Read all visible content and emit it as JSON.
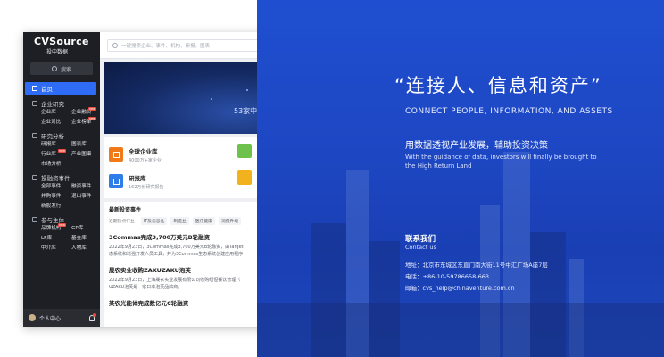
{
  "app": {
    "logo": {
      "main": "CVSource",
      "sub": "投中数据"
    },
    "sidebar": {
      "search_label": "搜索",
      "home": "首页",
      "groups": [
        {
          "title": "企业研究",
          "items": [
            {
              "label": "企业库",
              "badge": ""
            },
            {
              "label": "企业融资",
              "badge": "new"
            },
            {
              "label": "企业对比",
              "badge": ""
            },
            {
              "label": "企业榜单",
              "badge": "new"
            }
          ]
        },
        {
          "title": "研究分析",
          "items": [
            {
              "label": "研报库",
              "badge": ""
            },
            {
              "label": "图表库",
              "badge": ""
            },
            {
              "label": "行业库",
              "badge": "new"
            },
            {
              "label": "产业图谱",
              "badge": ""
            },
            {
              "label": "市场分析",
              "badge": ""
            }
          ]
        },
        {
          "title": "投融资事件",
          "items": [
            {
              "label": "全部事件",
              "badge": ""
            },
            {
              "label": "融资事件",
              "badge": ""
            },
            {
              "label": "并购事件",
              "badge": ""
            },
            {
              "label": "退出事件",
              "badge": ""
            },
            {
              "label": "新股发行",
              "badge": ""
            }
          ]
        },
        {
          "title": "参与主体",
          "items": [
            {
              "label": "品牌机构",
              "badge": "new"
            },
            {
              "label": "GP库",
              "badge": ""
            },
            {
              "label": "LP库",
              "badge": ""
            },
            {
              "label": "基金库",
              "badge": ""
            },
            {
              "label": "中介库",
              "badge": ""
            },
            {
              "label": "人物库",
              "badge": ""
            }
          ]
        }
      ],
      "user": "个人中心"
    },
    "top_search_placeholder": "一键搜索企业、事件、机构、研报、图表",
    "banner_text": "53家中",
    "cards": [
      {
        "title": "全球企业库",
        "sub": "4000万+家企业",
        "color": "#f07a1a"
      },
      {
        "title": "研报库",
        "sub": "162万份研究报告",
        "color": "#2f7de8"
      }
    ],
    "card_right_colors": [
      "#6ec24b",
      "#f2b21e"
    ],
    "events": {
      "title": "最新投资事件",
      "tags": [
        "近期热点行业",
        "IT及信息化",
        "制造业",
        "医疗健康",
        "消费升级"
      ],
      "items": [
        {
          "head": "3Commas完成3,700万美元B轮融资",
          "body": [
            "2022年9月23日，3Commas完成3,700万美元B轮融资，由Target",
            "态系统和增强开发人员工具，并为3Commas生态系统创建应用程序"
          ]
        },
        {
          "head": "晟农实业收购ZAKUZAKU泡芙",
          "body": [
            "2022年9月23日，上海晟农实业发展有限公司收购纽恒餐饮管理（",
            "UZAKU泡芙是一家日本泡芙品牌商。"
          ]
        },
        {
          "head": "某农光能体完成数亿元C轮融资",
          "body": []
        }
      ]
    }
  },
  "panel": {
    "tagline": "“连接人、信息和资产”",
    "tagline_en": "CONNECT PEOPLE, INFORMATION, AND ASSETS",
    "sub_cn": "用数据透视产业发展，辅助投资决策",
    "sub_en": "With the guidance of data, investors will finally be brought to the High Return Land",
    "contact_title": "联系我们",
    "contact_en": "Contact us",
    "address": "地址：北京市东城区东直门南大街11号中汇广场A座7层",
    "phone": "电话：+86-10-59786658-663",
    "email": "邮箱：cvs_help@chinaventure.com.cn"
  }
}
